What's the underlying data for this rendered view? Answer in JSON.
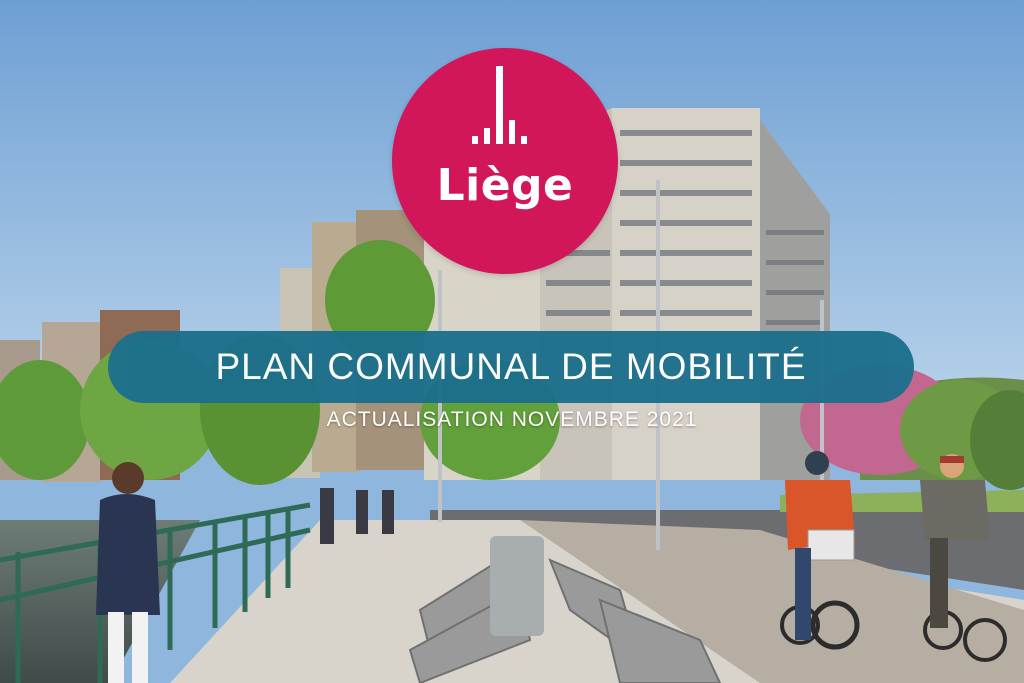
{
  "logo": {
    "name": "Liège",
    "color": "#d1165a",
    "icon": "bar-signal-mark-icon"
  },
  "banner": {
    "title": "PLAN COMMUNAL DE MOBILITÉ",
    "color": "#1c6f8c"
  },
  "subtitle": "ACTUALISATION NOVEMBRE 2021",
  "colors": {
    "sky": "#8fb6dc",
    "foliage": "#5f9a3a",
    "blossom": "#c2678f",
    "pavement": "#d8d4cc"
  }
}
